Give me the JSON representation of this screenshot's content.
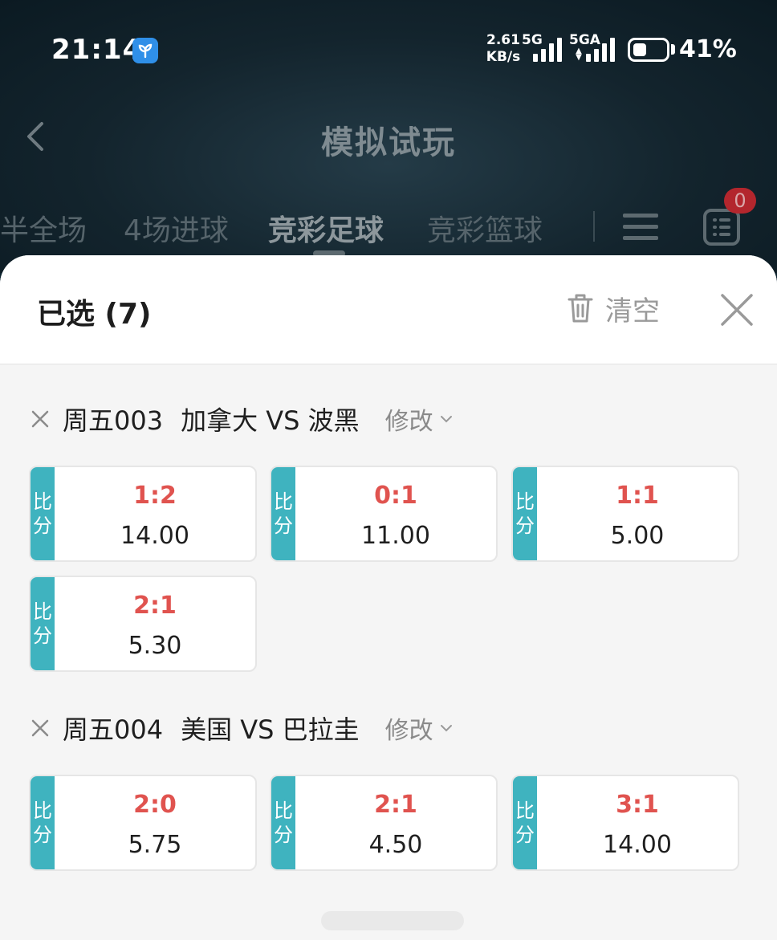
{
  "status_bar": {
    "time": "21:14",
    "speed_value": "2.61",
    "speed_unit": "KB/s",
    "sim1_label": "5G",
    "sim2_label": "5GA",
    "battery_percent": "41%",
    "battery_level": 0.41,
    "app_icon": "leaf-app-icon"
  },
  "nav": {
    "title": "模拟试玩",
    "back_icon": "chevron-left-icon",
    "badge_count": "0"
  },
  "tabs": [
    {
      "label": "半全场"
    },
    {
      "label": "4场进球"
    },
    {
      "label": "竞彩足球",
      "active": true
    },
    {
      "label": "竞彩篮球"
    }
  ],
  "sheet": {
    "title": "已选 (7)",
    "clear_label": "清空",
    "edit_label": "修改",
    "tag_line1": "比",
    "tag_line2": "分"
  },
  "matches": [
    {
      "code": "周五003",
      "teams": "加拿大 VS 波黑",
      "picks": [
        {
          "score": "1:2",
          "odds": "14.00"
        },
        {
          "score": "0:1",
          "odds": "11.00"
        },
        {
          "score": "1:1",
          "odds": "5.00"
        },
        {
          "score": "2:1",
          "odds": "5.30"
        }
      ]
    },
    {
      "code": "周五004",
      "teams": "美国 VS 巴拉圭",
      "picks": [
        {
          "score": "2:0",
          "odds": "5.75"
        },
        {
          "score": "2:1",
          "odds": "4.50"
        },
        {
          "score": "3:1",
          "odds": "14.00"
        }
      ]
    }
  ],
  "colors": {
    "accent_teal": "#3fb3bf",
    "score_red": "#e0534f",
    "badge_red": "#b3262d"
  }
}
